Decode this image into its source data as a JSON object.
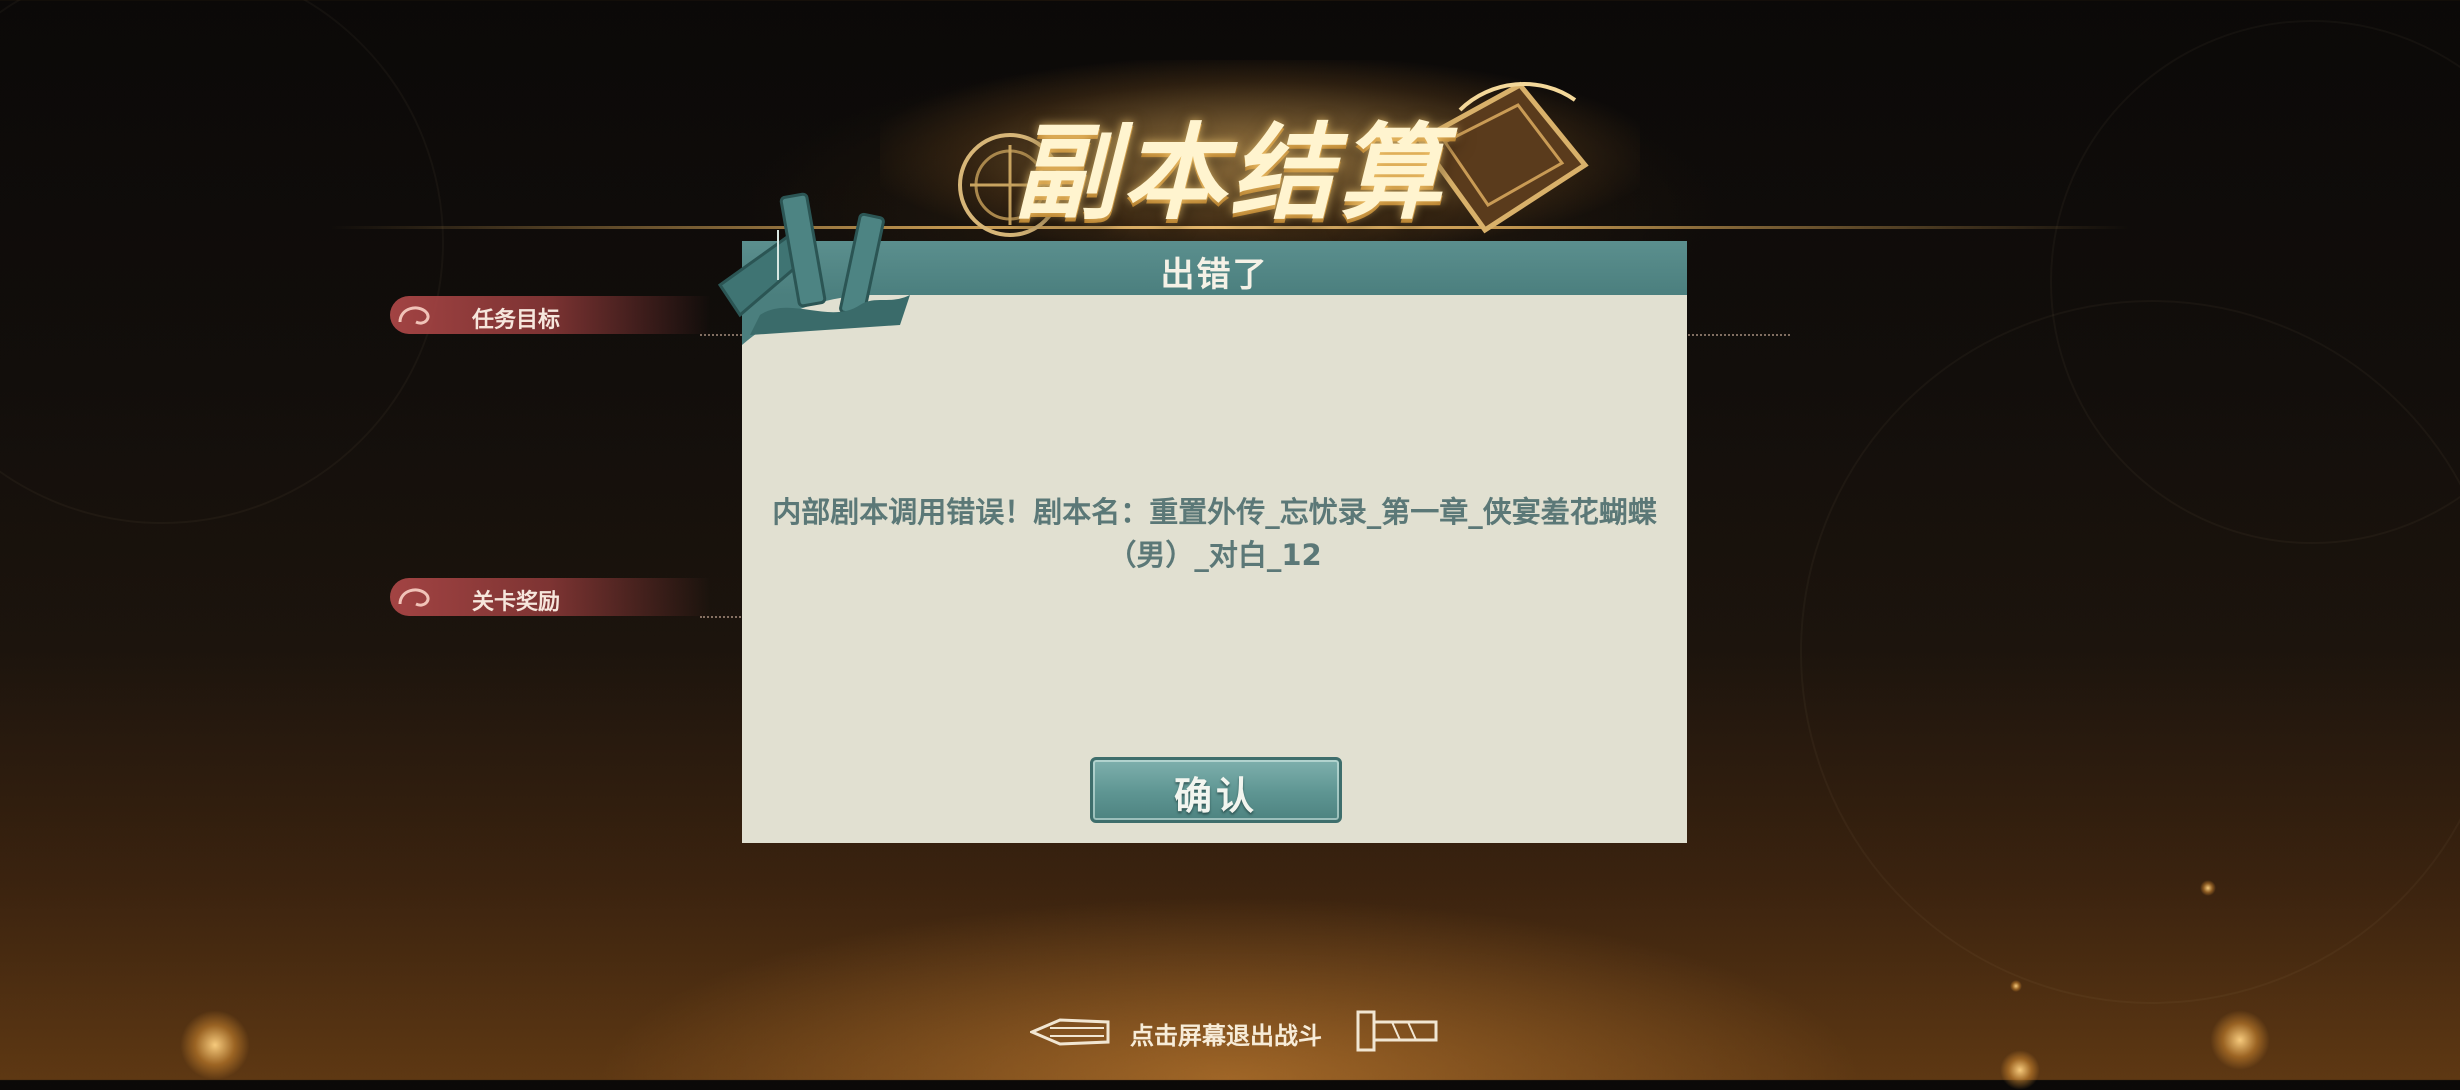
{
  "header": {
    "title": "副本结算"
  },
  "sections": {
    "objective_label": "任务目标",
    "reward_label": "关卡奖励"
  },
  "dialog": {
    "title": "出错了",
    "message": "内部剧本调用错误！剧本名：重置外传_忘忧录_第一章_侠宴羞花蝴蝶（男）_对白_12",
    "confirm_label": "确认"
  },
  "footer": {
    "exit_hint": "点击屏幕退出战斗"
  },
  "colors": {
    "dialog_header": "#4b7f7e",
    "dialog_body": "#e1e0d1",
    "message_text": "#5b7877",
    "section_label": "#aa4646"
  }
}
